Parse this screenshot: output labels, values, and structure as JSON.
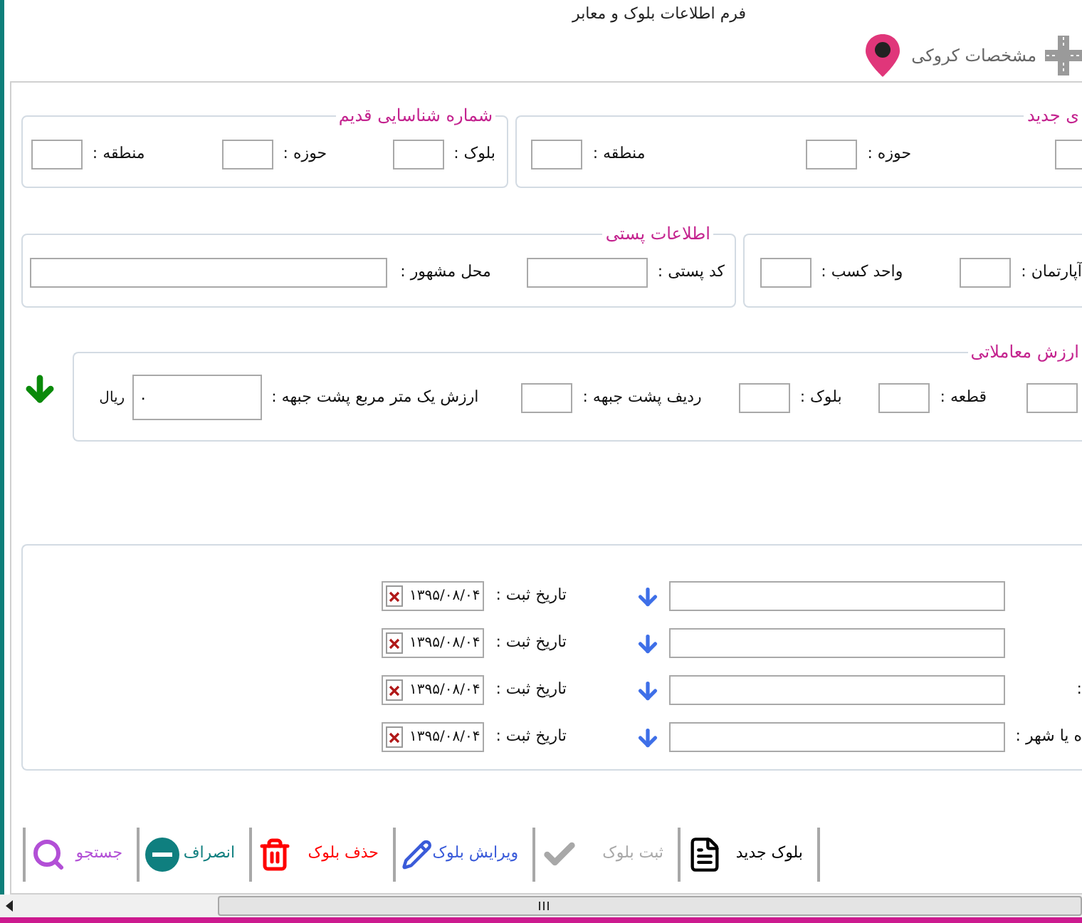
{
  "window": {
    "title": "فرم اطلاعات بلوک و معابر"
  },
  "tab": {
    "label": "مشخصات کروکی"
  },
  "new_id": {
    "legend": "ی جدید",
    "fields": [
      {
        "label": "حوزه :"
      },
      {
        "label": "منطقه :"
      }
    ]
  },
  "old_id": {
    "legend": "شماره شناسایی قدیم",
    "fields": [
      {
        "label": "بلوک :"
      },
      {
        "label": "حوزه :"
      },
      {
        "label": "منطقه :"
      }
    ]
  },
  "unit_info": {
    "fields": [
      {
        "label": "آپارتمان :"
      },
      {
        "label": "واحد کسب :"
      }
    ]
  },
  "postal": {
    "legend": "اطلاعات پستی",
    "fields": [
      {
        "label": "کد پستی :"
      },
      {
        "label": "محل مشهور :"
      }
    ]
  },
  "trade_value": {
    "legend": "ارزش معاملاتی",
    "fields": [
      {
        "label": "قطعه :"
      },
      {
        "label": "بلوک :"
      },
      {
        "label": "ردیف پشت جبهه :"
      },
      {
        "label": "ارزش یک متر مربع پشت جبهه :",
        "value": "۰"
      }
    ],
    "unit": "ریال"
  },
  "records": [
    {
      "date_label": "تاریخ ثبت :",
      "date": "۱۳۹۵/۰۸/۰۴"
    },
    {
      "date_label": "تاریخ ثبت :",
      "date": "۱۳۹۵/۰۸/۰۴"
    },
    {
      "label": ":",
      "date_label": "تاریخ ثبت :",
      "date": "۱۳۹۵/۰۸/۰۴"
    },
    {
      "label": "ه یا شهر :",
      "date_label": "تاریخ ثبت :",
      "date": "۱۳۹۵/۰۸/۰۴"
    }
  ],
  "toolbar": [
    {
      "kind": "new",
      "label": "بلوک جدید",
      "color": "#000000",
      "disabled": false
    },
    {
      "kind": "save",
      "label": "ثبت بلوک",
      "color": "#a8a8a8",
      "disabled": true
    },
    {
      "kind": "edit",
      "label": "ویرایش بلوک",
      "color": "#3a5bd9",
      "disabled": false
    },
    {
      "kind": "delete",
      "label": "حذف بلوک",
      "color": "#ff0000",
      "disabled": false
    },
    {
      "kind": "cancel",
      "label": "انصراف",
      "color": "#0f7f7f",
      "disabled": false
    },
    {
      "kind": "search",
      "label": "جستجو",
      "color": "#b24fd6",
      "disabled": false
    }
  ]
}
